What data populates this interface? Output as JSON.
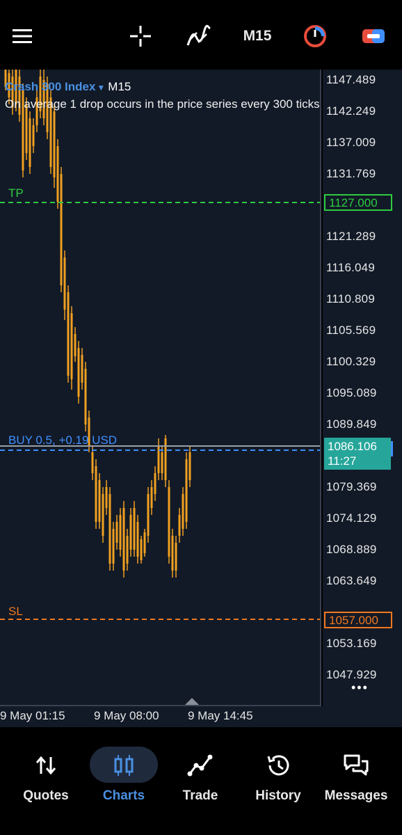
{
  "toolbar": {
    "timeframe": "M15",
    "icons": [
      "menu-icon",
      "crosshair-icon",
      "indicators-icon",
      "timeframe-label",
      "timer-icon",
      "toggle-icon"
    ]
  },
  "chart": {
    "symbol": "Crash 300 Index",
    "timeframe": "M15",
    "description": "On average 1 drop occurs in the price series every 300 ticks",
    "tp_label": "TP",
    "sl_label": "SL",
    "position_label": "BUY 0.5,  +0.19 USD",
    "tp_price": "1127.000",
    "sl_price": "1057.000",
    "current_price": "1086.106",
    "current_time": "11:27",
    "price_ticks": [
      "1147.489",
      "1142.249",
      "1137.009",
      "1131.769",
      "1121.289",
      "1116.049",
      "1110.809",
      "1105.569",
      "1100.329",
      "1095.089",
      "1089.849",
      "1079.369",
      "1074.129",
      "1068.889",
      "1063.649",
      "1053.169",
      "1047.929"
    ],
    "time_ticks": [
      "9 May 01:15",
      "9 May 08:00",
      "9 May 14:45"
    ],
    "more": "•••"
  },
  "colors": {
    "bull": "#2f8ee6",
    "bear": "#f0a020",
    "tp": "#2ecc40",
    "sl": "#f07820",
    "position": "#3f8fff",
    "bid": "#9aa0a6",
    "current_box": "#26a69a",
    "accent": "#4a90e2"
  },
  "nav": {
    "items": [
      {
        "label": "Quotes",
        "icon": "quotes-arrows-icon"
      },
      {
        "label": "Charts",
        "icon": "charts-candles-icon",
        "active": true
      },
      {
        "label": "Trade",
        "icon": "trade-line-icon"
      },
      {
        "label": "History",
        "icon": "history-clock-icon"
      },
      {
        "label": "Messages",
        "icon": "messages-bubbles-icon"
      }
    ]
  }
}
